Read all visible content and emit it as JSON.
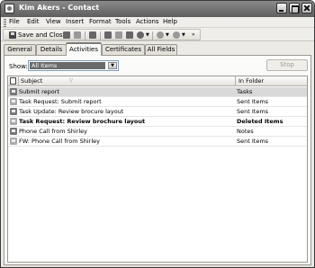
{
  "window": {
    "title": "Kim Akers - Contact"
  },
  "menu": [
    "File",
    "Edit",
    "View",
    "Insert",
    "Format",
    "Tools",
    "Actions",
    "Help"
  ],
  "toolbar": {
    "save_close_label": "Save and Close"
  },
  "tabs": [
    "General",
    "Details",
    "Activities",
    "Certificates",
    "All Fields"
  ],
  "active_tab": "Activities",
  "filter": {
    "label": "Show:",
    "value": "All Items",
    "stop_label": "Stop"
  },
  "table": {
    "columns": [
      "Subject",
      "In Folder"
    ],
    "rows": [
      {
        "subject": "Submit report",
        "folder": "Tasks",
        "bold": false,
        "selected": true,
        "icon": "task-icon"
      },
      {
        "subject": "Task Request: Submit report",
        "folder": "Sent Items",
        "bold": false,
        "selected": false,
        "icon": "task-request-icon"
      },
      {
        "subject": "Task Update: Review brocure layout",
        "folder": "Sent Items",
        "bold": false,
        "selected": false,
        "icon": "task-update-icon"
      },
      {
        "subject": "Task Request: Review brochure layout",
        "folder": "Deleted Items",
        "bold": true,
        "selected": false,
        "icon": "task-request-icon"
      },
      {
        "subject": "Phone Call from Shirley",
        "folder": "Notes",
        "bold": false,
        "selected": false,
        "icon": "note-icon"
      },
      {
        "subject": "FW: Phone Call from Shirley",
        "folder": "Sent Items",
        "bold": false,
        "selected": false,
        "icon": "mail-icon"
      }
    ]
  }
}
